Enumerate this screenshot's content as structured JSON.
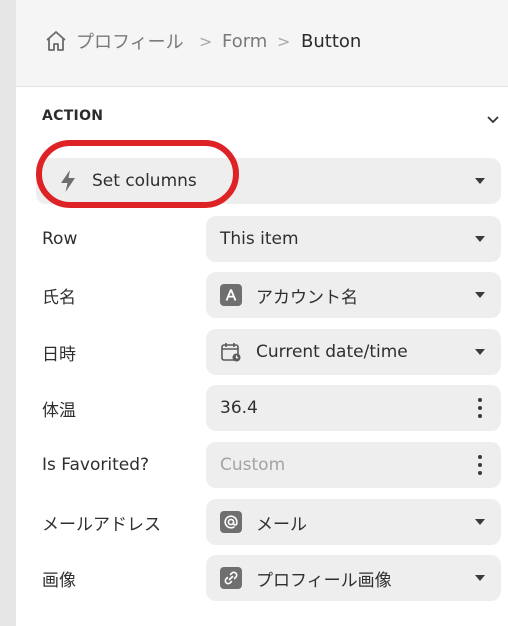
{
  "breadcrumb": {
    "items": [
      "プロフィール",
      "Form",
      "Button"
    ],
    "separator": ">"
  },
  "action": {
    "section_title": "ACTION",
    "selected": "Set columns"
  },
  "columns": [
    {
      "label": "Row",
      "value": "This item",
      "icon": null,
      "control": "dropdown"
    },
    {
      "label": "氏名",
      "value": "アカウント名",
      "icon": "text-type-icon",
      "control": "dropdown"
    },
    {
      "label": "日時",
      "value": "Current date/time",
      "icon": "calendar-icon",
      "control": "dropdown"
    },
    {
      "label": "体温",
      "value": "36.4",
      "icon": null,
      "control": "menu"
    },
    {
      "label": "Is Favorited?",
      "placeholder": "Custom",
      "icon": null,
      "control": "menu"
    },
    {
      "label": "メールアドレス",
      "value": "メール",
      "icon": "at-sign-icon",
      "control": "dropdown"
    },
    {
      "label": "画像",
      "value": "プロフィール画像",
      "icon": "link-icon",
      "control": "dropdown"
    }
  ],
  "colors": {
    "highlight": "#dd2326",
    "field_bg": "#eeeeee",
    "panel_bg": "#ffffff"
  }
}
